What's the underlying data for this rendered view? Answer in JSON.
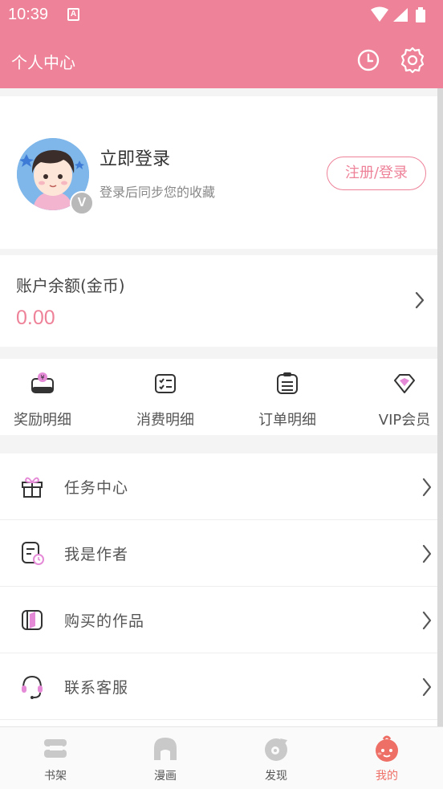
{
  "status_bar": {
    "time": "10:39",
    "app_icon_letter": "A",
    "icons": [
      "wifi-icon",
      "signal-icon",
      "battery-icon"
    ]
  },
  "app_bar": {
    "title": "个人中心",
    "icons": [
      "history-icon",
      "settings-icon"
    ]
  },
  "profile": {
    "title": "立即登录",
    "subtitle": "登录后同步您的收藏",
    "badge": "V",
    "register_button": "注册/登录"
  },
  "balance": {
    "label": "账户余额(金币)",
    "value": "0.00"
  },
  "shortcuts": [
    {
      "label": "奖励明细",
      "icon": "reward-wallet-icon"
    },
    {
      "label": "消费明细",
      "icon": "consumption-list-icon"
    },
    {
      "label": "订单明细",
      "icon": "order-list-icon"
    },
    {
      "label": "VIP会员",
      "icon": "vip-diamond-icon"
    }
  ],
  "menu": [
    {
      "label": "任务中心",
      "icon": "gift-icon"
    },
    {
      "label": "我是作者",
      "icon": "author-icon"
    },
    {
      "label": "购买的作品",
      "icon": "book-icon"
    },
    {
      "label": "联系客服",
      "icon": "headset-icon"
    }
  ],
  "tabs": [
    {
      "label": "书架",
      "icon": "bookshelf-icon"
    },
    {
      "label": "漫画",
      "icon": "comic-icon"
    },
    {
      "label": "发现",
      "icon": "discover-icon"
    },
    {
      "label": "我的",
      "icon": "mine-icon",
      "active": true
    }
  ],
  "colors": {
    "accent": "#ee8299",
    "active_tab": "#ee6f66",
    "background": "#f4f4f4"
  }
}
